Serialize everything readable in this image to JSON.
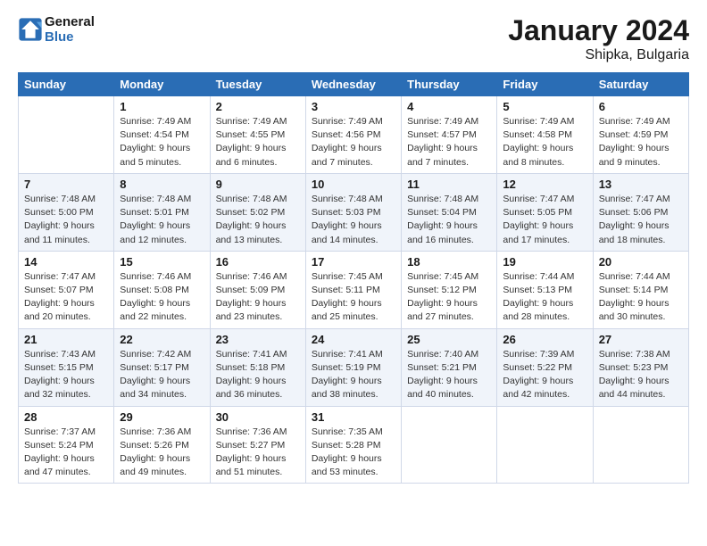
{
  "header": {
    "logo_line1": "General",
    "logo_line2": "Blue",
    "main_title": "January 2024",
    "subtitle": "Shipka, Bulgaria"
  },
  "days_of_week": [
    "Sunday",
    "Monday",
    "Tuesday",
    "Wednesday",
    "Thursday",
    "Friday",
    "Saturday"
  ],
  "weeks": [
    [
      {
        "num": "",
        "sunrise": "",
        "sunset": "",
        "daylight": ""
      },
      {
        "num": "1",
        "sunrise": "7:49 AM",
        "sunset": "4:54 PM",
        "daylight": "9 hours and 5 minutes."
      },
      {
        "num": "2",
        "sunrise": "7:49 AM",
        "sunset": "4:55 PM",
        "daylight": "9 hours and 6 minutes."
      },
      {
        "num": "3",
        "sunrise": "7:49 AM",
        "sunset": "4:56 PM",
        "daylight": "9 hours and 7 minutes."
      },
      {
        "num": "4",
        "sunrise": "7:49 AM",
        "sunset": "4:57 PM",
        "daylight": "9 hours and 7 minutes."
      },
      {
        "num": "5",
        "sunrise": "7:49 AM",
        "sunset": "4:58 PM",
        "daylight": "9 hours and 8 minutes."
      },
      {
        "num": "6",
        "sunrise": "7:49 AM",
        "sunset": "4:59 PM",
        "daylight": "9 hours and 9 minutes."
      }
    ],
    [
      {
        "num": "7",
        "sunrise": "7:48 AM",
        "sunset": "5:00 PM",
        "daylight": "9 hours and 11 minutes."
      },
      {
        "num": "8",
        "sunrise": "7:48 AM",
        "sunset": "5:01 PM",
        "daylight": "9 hours and 12 minutes."
      },
      {
        "num": "9",
        "sunrise": "7:48 AM",
        "sunset": "5:02 PM",
        "daylight": "9 hours and 13 minutes."
      },
      {
        "num": "10",
        "sunrise": "7:48 AM",
        "sunset": "5:03 PM",
        "daylight": "9 hours and 14 minutes."
      },
      {
        "num": "11",
        "sunrise": "7:48 AM",
        "sunset": "5:04 PM",
        "daylight": "9 hours and 16 minutes."
      },
      {
        "num": "12",
        "sunrise": "7:47 AM",
        "sunset": "5:05 PM",
        "daylight": "9 hours and 17 minutes."
      },
      {
        "num": "13",
        "sunrise": "7:47 AM",
        "sunset": "5:06 PM",
        "daylight": "9 hours and 18 minutes."
      }
    ],
    [
      {
        "num": "14",
        "sunrise": "7:47 AM",
        "sunset": "5:07 PM",
        "daylight": "9 hours and 20 minutes."
      },
      {
        "num": "15",
        "sunrise": "7:46 AM",
        "sunset": "5:08 PM",
        "daylight": "9 hours and 22 minutes."
      },
      {
        "num": "16",
        "sunrise": "7:46 AM",
        "sunset": "5:09 PM",
        "daylight": "9 hours and 23 minutes."
      },
      {
        "num": "17",
        "sunrise": "7:45 AM",
        "sunset": "5:11 PM",
        "daylight": "9 hours and 25 minutes."
      },
      {
        "num": "18",
        "sunrise": "7:45 AM",
        "sunset": "5:12 PM",
        "daylight": "9 hours and 27 minutes."
      },
      {
        "num": "19",
        "sunrise": "7:44 AM",
        "sunset": "5:13 PM",
        "daylight": "9 hours and 28 minutes."
      },
      {
        "num": "20",
        "sunrise": "7:44 AM",
        "sunset": "5:14 PM",
        "daylight": "9 hours and 30 minutes."
      }
    ],
    [
      {
        "num": "21",
        "sunrise": "7:43 AM",
        "sunset": "5:15 PM",
        "daylight": "9 hours and 32 minutes."
      },
      {
        "num": "22",
        "sunrise": "7:42 AM",
        "sunset": "5:17 PM",
        "daylight": "9 hours and 34 minutes."
      },
      {
        "num": "23",
        "sunrise": "7:41 AM",
        "sunset": "5:18 PM",
        "daylight": "9 hours and 36 minutes."
      },
      {
        "num": "24",
        "sunrise": "7:41 AM",
        "sunset": "5:19 PM",
        "daylight": "9 hours and 38 minutes."
      },
      {
        "num": "25",
        "sunrise": "7:40 AM",
        "sunset": "5:21 PM",
        "daylight": "9 hours and 40 minutes."
      },
      {
        "num": "26",
        "sunrise": "7:39 AM",
        "sunset": "5:22 PM",
        "daylight": "9 hours and 42 minutes."
      },
      {
        "num": "27",
        "sunrise": "7:38 AM",
        "sunset": "5:23 PM",
        "daylight": "9 hours and 44 minutes."
      }
    ],
    [
      {
        "num": "28",
        "sunrise": "7:37 AM",
        "sunset": "5:24 PM",
        "daylight": "9 hours and 47 minutes."
      },
      {
        "num": "29",
        "sunrise": "7:36 AM",
        "sunset": "5:26 PM",
        "daylight": "9 hours and 49 minutes."
      },
      {
        "num": "30",
        "sunrise": "7:36 AM",
        "sunset": "5:27 PM",
        "daylight": "9 hours and 51 minutes."
      },
      {
        "num": "31",
        "sunrise": "7:35 AM",
        "sunset": "5:28 PM",
        "daylight": "9 hours and 53 minutes."
      },
      {
        "num": "",
        "sunrise": "",
        "sunset": "",
        "daylight": ""
      },
      {
        "num": "",
        "sunrise": "",
        "sunset": "",
        "daylight": ""
      },
      {
        "num": "",
        "sunrise": "",
        "sunset": "",
        "daylight": ""
      }
    ]
  ],
  "labels": {
    "sunrise_prefix": "Sunrise: ",
    "sunset_prefix": "Sunset: ",
    "daylight_prefix": "Daylight: "
  }
}
